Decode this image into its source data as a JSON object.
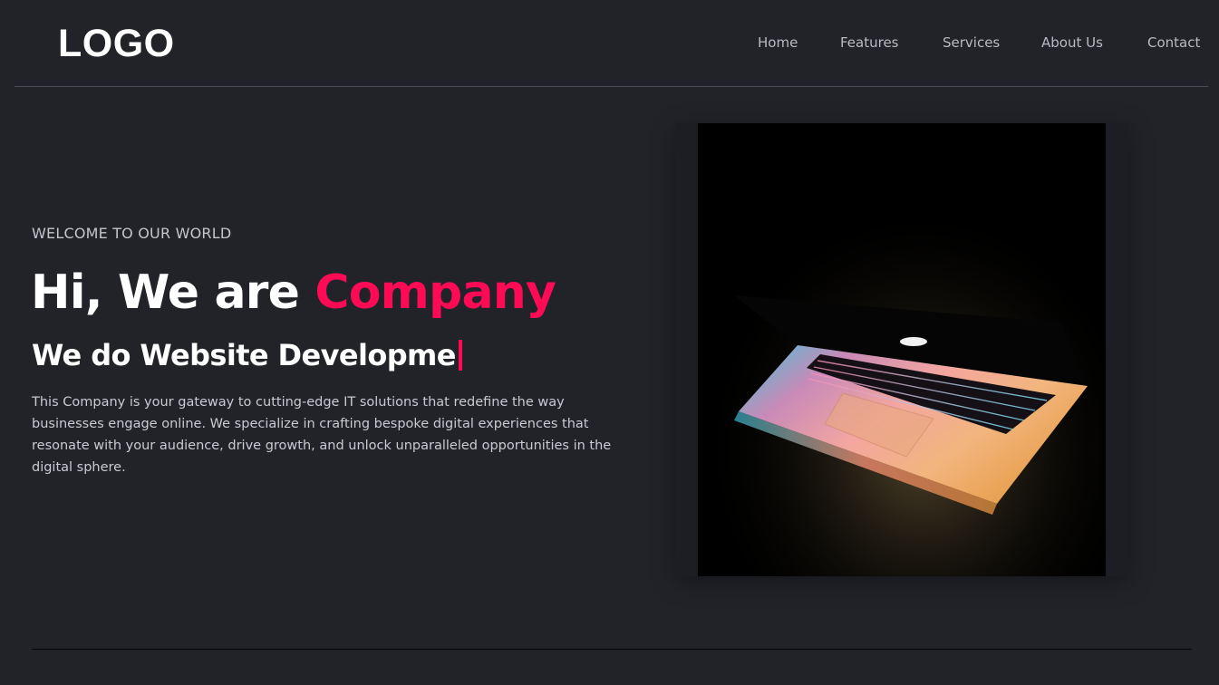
{
  "header": {
    "logo": "LOGO",
    "nav": {
      "home": "Home",
      "features": "Features",
      "services": "Services",
      "about": "About Us",
      "contact": "Contact"
    }
  },
  "hero": {
    "eyebrow": "WELCOME TO OUR WORLD",
    "title_prefix": "Hi, We are ",
    "title_accent": "Company",
    "subtitle": "We do Website Developme",
    "description": "This Company is your gateway to cutting-edge IT solutions that redefine the way businesses engage online. We specialize in crafting bespoke digital experiences that resonate with your audience, drive growth, and unlock unparalleled opportunities in the digital sphere."
  },
  "image": {
    "icon": "laptop-photo"
  },
  "colors": {
    "background": "#212329",
    "accent": "#ff0a54",
    "nav_text": "#b9bbc1"
  }
}
